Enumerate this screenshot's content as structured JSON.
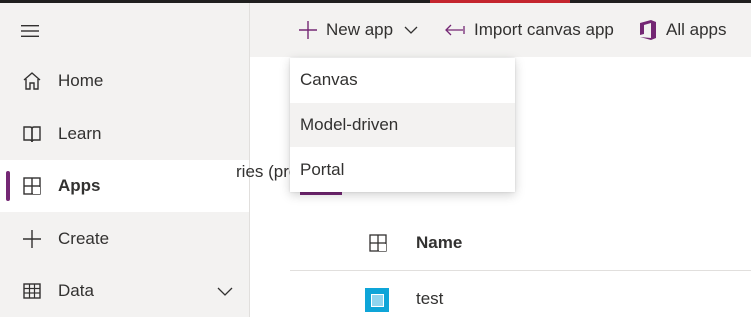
{
  "nav": {
    "items": [
      {
        "label": "Home",
        "icon": "home-icon"
      },
      {
        "label": "Learn",
        "icon": "book-icon"
      },
      {
        "label": "Apps",
        "icon": "apps-icon",
        "active": true
      },
      {
        "label": "Create",
        "icon": "plus-icon"
      },
      {
        "label": "Data",
        "icon": "table-icon",
        "expandable": true
      }
    ]
  },
  "commandbar": {
    "new_app_label": "New app",
    "import_label": "Import canvas app",
    "all_apps_label": "All apps"
  },
  "dropdown": {
    "items": [
      "Canvas",
      "Model-driven",
      "Portal"
    ],
    "highlighted": "Model-driven"
  },
  "main": {
    "tab_partial": "ries (preview)",
    "table": {
      "columns": [
        "Name"
      ],
      "rows": [
        {
          "name": "test"
        }
      ]
    }
  },
  "colors": {
    "accent": "#742774",
    "sidebar_bg": "#f3f2f1",
    "app_icon": "#0ea5d8",
    "office_icon": "#d83b01"
  }
}
